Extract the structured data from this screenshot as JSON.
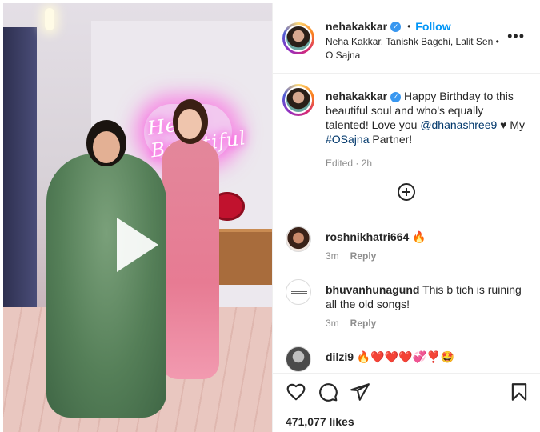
{
  "post": {
    "username": "nehakakkar",
    "follow_label": "Follow",
    "separator": "•",
    "audio_line": "Neha Kakkar, Tanishk Bagchi, Lalit Sen • O Sajna",
    "media_neon_text": "Hello Beautiful"
  },
  "caption": {
    "username": "nehakakkar",
    "text_before": "Happy Birthday to this beautiful soul and who's equally talented! Love you ",
    "mention": "@dhanashree9",
    "text_middle": " ♥ My ",
    "hashtag": "#OSajna",
    "text_after": " Partner!",
    "meta": "Edited · 2h"
  },
  "comments": [
    {
      "username": "roshnikhatri664",
      "text": "🔥",
      "time": "3m",
      "reply": "Reply"
    },
    {
      "username": "bhuvanhunagund",
      "text": "This b tich is ruining all the old songs!",
      "time": "3m",
      "reply": "Reply"
    },
    {
      "username": "dilzi9",
      "text": "🔥❤️❤️❤️💞❣️🤩"
    }
  ],
  "actions": {
    "likes": "471,077 likes"
  },
  "icons": {
    "verified": "verified-badge-icon",
    "more": "more-options-icon",
    "load_more": "plus-circle-icon",
    "like": "heart-icon",
    "comment": "comment-icon",
    "share": "share-icon",
    "save": "bookmark-icon",
    "play": "play-icon"
  },
  "colors": {
    "accent": "#0095f6",
    "verified": "#3897f0",
    "link": "#00376b",
    "muted": "#8e8e8e",
    "text": "#262626"
  }
}
